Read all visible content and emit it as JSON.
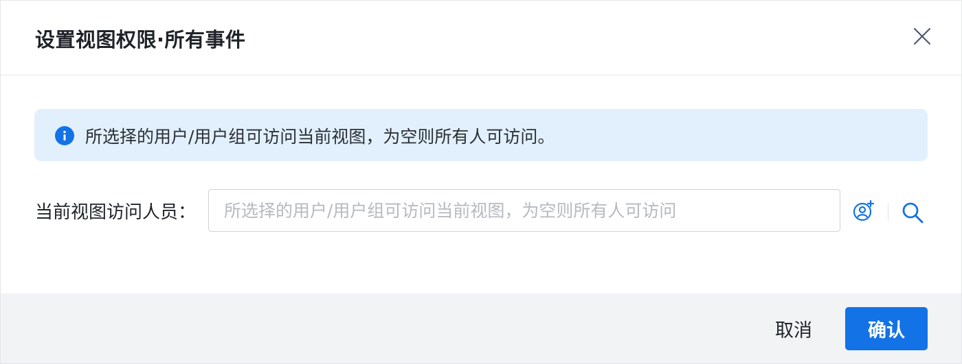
{
  "dialog": {
    "title": "设置视图权限·所有事件",
    "close_icon": "close-icon"
  },
  "info": {
    "icon": "info-icon",
    "text": "所选择的用户/用户组可访问当前视图，为空则所有人可访问。"
  },
  "field": {
    "label": "当前视图访问人员：",
    "value": "",
    "placeholder": "所选择的用户/用户组可访问当前视图，为空则所有人可访问",
    "add_icon": "add-user-icon",
    "search_icon": "search-icon"
  },
  "footer": {
    "cancel_label": "取消",
    "confirm_label": "确认"
  },
  "colors": {
    "accent": "#1372e6",
    "info_bg": "#e1f0fc",
    "footer_bg": "#f2f3f5"
  }
}
